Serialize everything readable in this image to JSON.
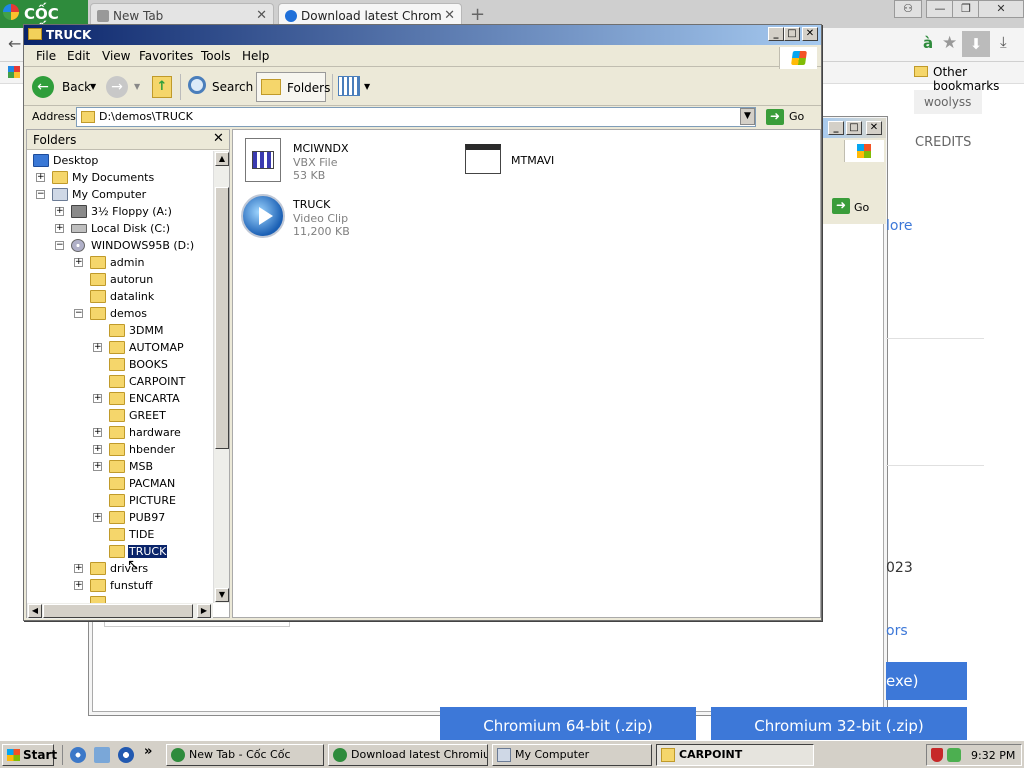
{
  "browser": {
    "logo": "CỐC CỐC",
    "tabs": [
      {
        "label": "New Tab",
        "active": false
      },
      {
        "label": "Download latest Chromium re",
        "active": true
      }
    ],
    "other_bookmarks": "Other bookmarks",
    "user_name": "woolyss",
    "page": {
      "credits": "CREDITS",
      "more_link": "lore",
      "year_fragment": "023",
      "ors_fragment": "ors",
      "exe_fragment": "exe)",
      "download_64": "Chromium 64-bit (.zip)",
      "download_32": "Chromium 32-bit (.zip)",
      "go_label": "Go"
    }
  },
  "explorer": {
    "title": "TRUCK",
    "menu": [
      "File",
      "Edit",
      "View",
      "Favorites",
      "Tools",
      "Help"
    ],
    "toolbar": {
      "back": "Back",
      "search": "Search",
      "folders": "Folders"
    },
    "address": {
      "label": "Address",
      "value": "D:\\demos\\TRUCK",
      "go": "Go"
    },
    "folders_pane": {
      "title": "Folders",
      "tree": [
        {
          "label": "Desktop",
          "level": 0,
          "expander": "",
          "icon": "desktop-icon"
        },
        {
          "label": "My Documents",
          "level": 1,
          "expander": "+",
          "icon": "folder-icon"
        },
        {
          "label": "My Computer",
          "level": 1,
          "expander": "−",
          "icon": "computer-icon"
        },
        {
          "label": "3½ Floppy (A:)",
          "level": 2,
          "expander": "+",
          "icon": "floppy-icon"
        },
        {
          "label": "Local Disk (C:)",
          "level": 2,
          "expander": "+",
          "icon": "disk-icon"
        },
        {
          "label": "WINDOWS95B (D:)",
          "level": 2,
          "expander": "−",
          "icon": "cd-icon"
        },
        {
          "label": "admin",
          "level": 3,
          "expander": "+",
          "icon": "folder-icon"
        },
        {
          "label": "autorun",
          "level": 3,
          "expander": "",
          "icon": "folder-icon"
        },
        {
          "label": "datalink",
          "level": 3,
          "expander": "",
          "icon": "folder-icon"
        },
        {
          "label": "demos",
          "level": 3,
          "expander": "−",
          "icon": "folder-icon"
        },
        {
          "label": "3DMM",
          "level": 4,
          "expander": "",
          "icon": "folder-icon"
        },
        {
          "label": "AUTOMAP",
          "level": 4,
          "expander": "+",
          "icon": "folder-icon"
        },
        {
          "label": "BOOKS",
          "level": 4,
          "expander": "",
          "icon": "folder-icon"
        },
        {
          "label": "CARPOINT",
          "level": 4,
          "expander": "",
          "icon": "folder-icon"
        },
        {
          "label": "ENCARTA",
          "level": 4,
          "expander": "+",
          "icon": "folder-icon"
        },
        {
          "label": "GREET",
          "level": 4,
          "expander": "",
          "icon": "folder-icon"
        },
        {
          "label": "hardware",
          "level": 4,
          "expander": "+",
          "icon": "folder-icon"
        },
        {
          "label": "hbender",
          "level": 4,
          "expander": "+",
          "icon": "folder-icon"
        },
        {
          "label": "MSB",
          "level": 4,
          "expander": "+",
          "icon": "folder-icon"
        },
        {
          "label": "PACMAN",
          "level": 4,
          "expander": "",
          "icon": "folder-icon"
        },
        {
          "label": "PICTURE",
          "level": 4,
          "expander": "",
          "icon": "folder-icon"
        },
        {
          "label": "PUB97",
          "level": 4,
          "expander": "+",
          "icon": "folder-icon"
        },
        {
          "label": "TIDE",
          "level": 4,
          "expander": "",
          "icon": "folder-icon"
        },
        {
          "label": "TRUCK",
          "level": 4,
          "expander": "",
          "icon": "folder-icon",
          "selected": true
        },
        {
          "label": "drivers",
          "level": 3,
          "expander": "+",
          "icon": "folder-icon"
        },
        {
          "label": "funstuff",
          "level": 3,
          "expander": "+",
          "icon": "folder-icon"
        }
      ]
    },
    "files": [
      {
        "name": "MCIWNDX",
        "type": "VBX File",
        "size": "53 KB",
        "icon": "vbx-file-icon"
      },
      {
        "name": "MTMAVI",
        "type": "",
        "size": "",
        "icon": "window-app-icon"
      },
      {
        "name": "TRUCK",
        "type": "Video Clip",
        "size": "11,200 KB",
        "icon": "media-player-icon"
      }
    ]
  },
  "taskbar": {
    "start": "Start",
    "tasks": [
      {
        "label": "New Tab - Cốc Cốc",
        "active": false
      },
      {
        "label": "Download latest Chromiu...",
        "active": false
      },
      {
        "label": "My Computer",
        "active": false
      },
      {
        "label": "CARPOINT",
        "active": true
      }
    ],
    "quicklaunch_more": "»",
    "clock": "9:32 PM"
  },
  "colors": {
    "titlebar_start": "#0a246a",
    "titlebar_end": "#a6caf0",
    "selection": "#0a246a",
    "download_button": "#3d78d8",
    "coccoc_green": "#2e8b3c"
  }
}
